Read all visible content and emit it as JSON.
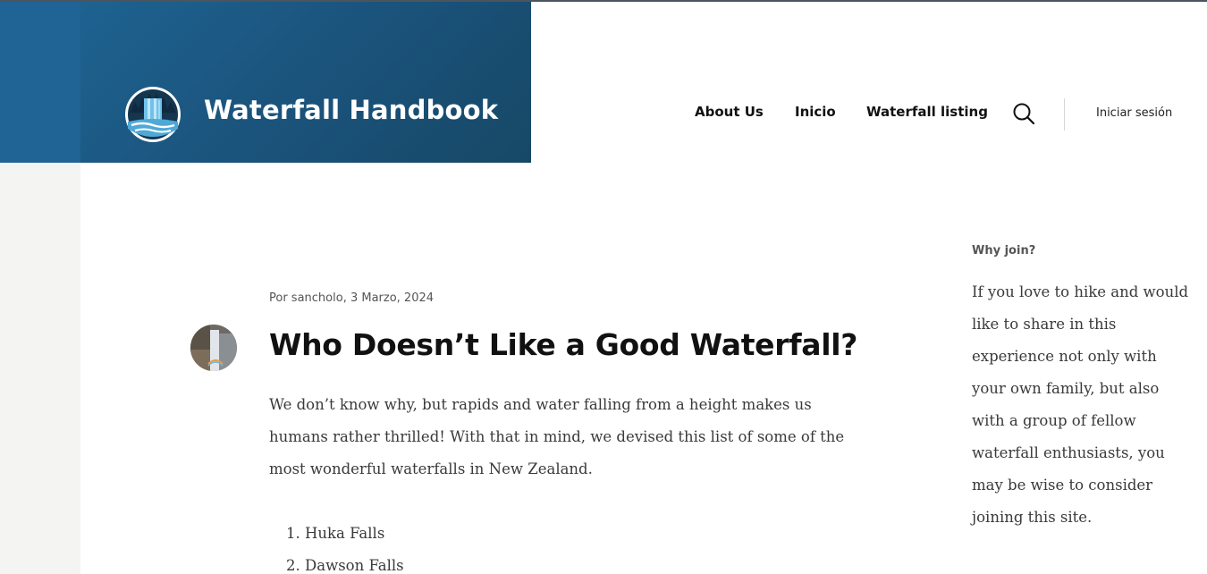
{
  "header": {
    "site_title": "Waterfall Handbook",
    "brand_color": "#1a527a",
    "nav": {
      "about": "About Us",
      "inicio": "Inicio",
      "listing": "Waterfall listing"
    },
    "search_icon": "search-icon",
    "login_label": "Iniciar sesión"
  },
  "post": {
    "meta": "Por sancholo, 3 Marzo, 2024",
    "title": "Who Doesn’t Like a Good Waterfall?",
    "body": "We don’t know why, but rapids and water falling from a height makes us humans rather thrilled! With that in mind, we devised this list of some of the most wonderful waterfalls in New Zealand.",
    "list": [
      "Huka Falls",
      "Dawson Falls"
    ]
  },
  "sidebar": {
    "heading": "Why join?",
    "text": "If you love to hike and would like to share in this experience not only with your own family, but also with a group of fellow waterfall enthusiasts, you may be wise to consider joining this site."
  }
}
